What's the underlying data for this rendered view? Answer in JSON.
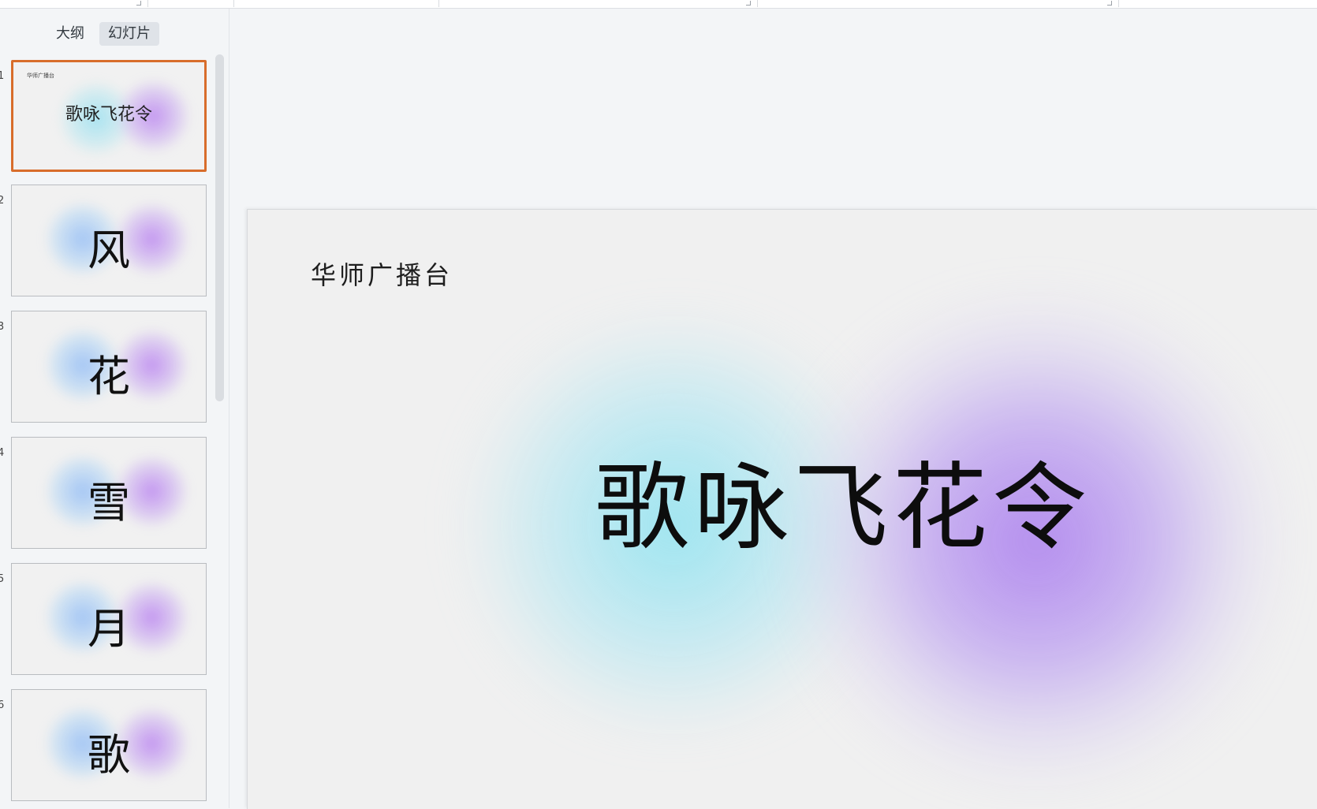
{
  "view_tabs": {
    "outline": "大纲",
    "slides": "幻灯片",
    "active": "slides"
  },
  "slides": [
    {
      "number": "1",
      "mini_title": "华师广播台",
      "text": "歌咏飞花令",
      "selected": true
    },
    {
      "number": "2",
      "text": "风",
      "selected": false
    },
    {
      "number": "3",
      "text": "花",
      "selected": false
    },
    {
      "number": "4",
      "text": "雪",
      "selected": false
    },
    {
      "number": "5",
      "text": "月",
      "selected": false
    },
    {
      "number": "6",
      "text": "歌",
      "selected": false
    }
  ],
  "current_slide": {
    "title": "华师广播台",
    "main_text": "歌咏飞花令"
  },
  "colors": {
    "selection_border": "#d86d2b",
    "glow_cyan": "#96e4f0",
    "glow_purple": "#b28aee"
  }
}
